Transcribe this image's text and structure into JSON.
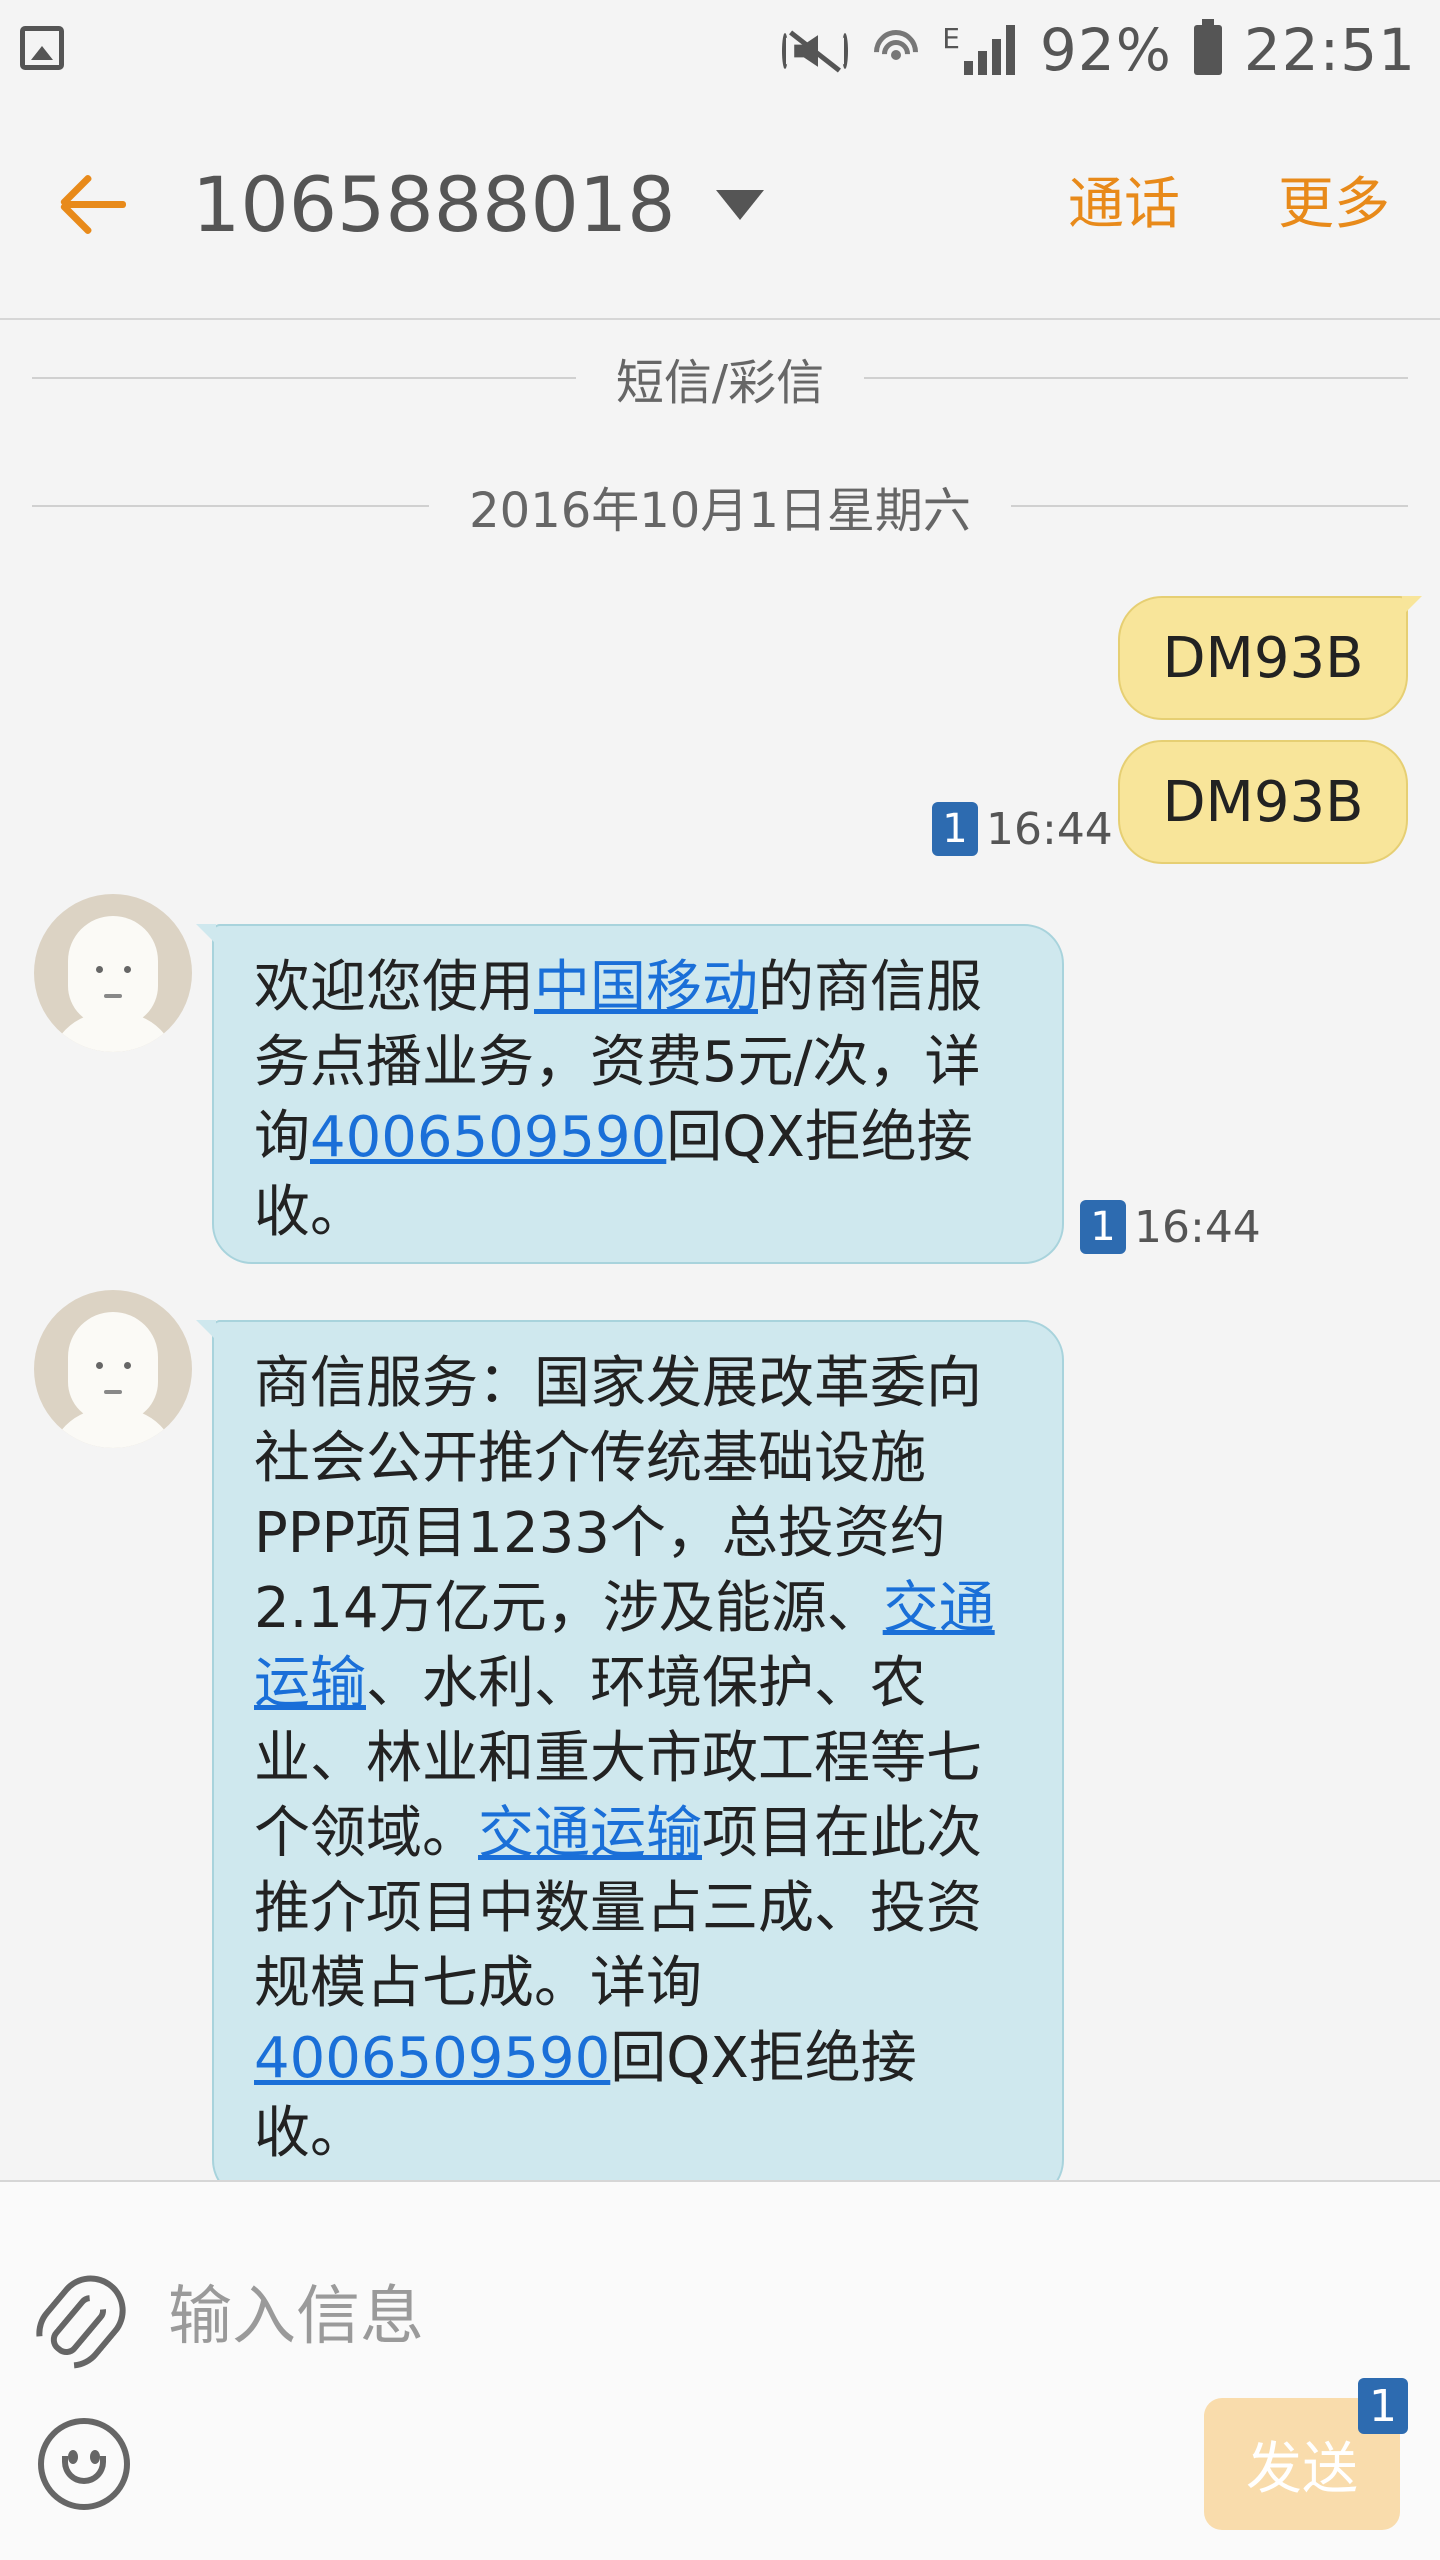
{
  "status_bar": {
    "network_type": "E",
    "battery_percent": "92%",
    "time": "22:51"
  },
  "header": {
    "contact": "1065888018",
    "call_label": "通话",
    "more_label": "更多"
  },
  "conversation": {
    "channel_divider": "短信/彩信",
    "date_divider": "2016年10月1日星期六",
    "outgoing": [
      {
        "text": "DM93B"
      },
      {
        "text": "DM93B"
      }
    ],
    "outgoing_meta": {
      "sim": "1",
      "time": "16:44"
    },
    "incoming": [
      {
        "parts": [
          {
            "text": "欢迎您使用",
            "link": false
          },
          {
            "text": "中国移动",
            "link": true
          },
          {
            "text": "的商信服务点播业务，资费5元/次，详询",
            "link": false
          },
          {
            "text": "4006509590",
            "link": true
          },
          {
            "text": "回QX拒绝接收。",
            "link": false
          }
        ],
        "sim": "1",
        "time": "16:44"
      },
      {
        "parts": [
          {
            "text": "商信服务：国家发展改革委向社会公开推介传统基础设施PPP项目1233个，总投资约2.14万亿元，涉及能源、",
            "link": false
          },
          {
            "text": "交通运输",
            "link": true
          },
          {
            "text": "、水利、环境保护、农业、林业和重大市政工程等七个领域。",
            "link": false
          },
          {
            "text": "交通运输",
            "link": true
          },
          {
            "text": "项目在此次推介项目中数量占三成、投资规模占七成。详询",
            "link": false
          },
          {
            "text": "4006509590",
            "link": true
          },
          {
            "text": "回QX拒绝接收。",
            "link": false
          }
        ]
      }
    ]
  },
  "composer": {
    "placeholder": "输入信息",
    "send_label": "发送",
    "sim_badge": "1"
  }
}
